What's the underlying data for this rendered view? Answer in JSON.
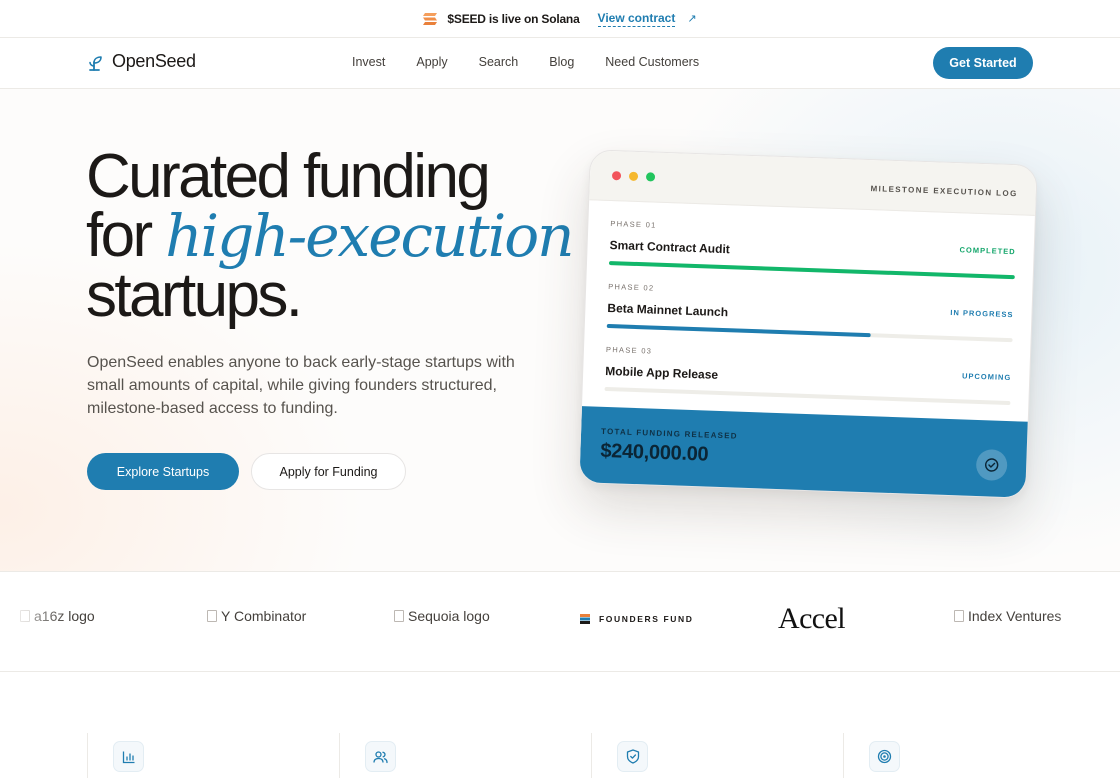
{
  "announcement": {
    "icon": "solana-icon",
    "text": "$SEED is live on Solana",
    "link_label": "View contract",
    "link_arrow": "↗"
  },
  "nav": {
    "brand": "OpenSeed",
    "links": [
      "Invest",
      "Apply",
      "Search",
      "Blog",
      "Need Customers"
    ],
    "cta": "Get Started"
  },
  "hero": {
    "title_line1": "Curated funding",
    "title_for": "for",
    "title_em": "high-execution",
    "title_line3": "startups.",
    "description": "OpenSeed enables anyone to back early-stage startups with small amounts of capital, while giving founders structured, milestone-based access to funding.",
    "primary_button": "Explore Startups",
    "secondary_button": "Apply for Funding"
  },
  "card": {
    "title": "MILESTONE EXECUTION LOG",
    "phases": [
      {
        "label": "PHASE 01",
        "name": "Smart Contract Audit",
        "status": "COMPLETED",
        "progress": 1.0,
        "status_color": "#12a56a",
        "bar_color": "#12b76a"
      },
      {
        "label": "PHASE 02",
        "name": "Beta Mainnet Launch",
        "status": "IN PROGRESS",
        "progress": 0.65,
        "status_color": "#1f7db0",
        "bar_color": "#1f7db0"
      },
      {
        "label": "PHASE 03",
        "name": "Mobile App Release",
        "status": "UPCOMING",
        "progress": 0.0,
        "status_color": "#1f7db0",
        "bar_color": "#1f7db0"
      }
    ],
    "footer_label": "TOTAL FUNDING RELEASED",
    "footer_amount": "$240,000.00"
  },
  "logos": {
    "a16z": "a16z logo",
    "yc": "Y Combinator",
    "sequoia": "Sequoia logo",
    "founders_fund": "FOUNDERS FUND",
    "accel": "Accel",
    "index": "Index Ventures"
  },
  "features": {
    "icons": [
      "bar-chart-icon",
      "users-icon",
      "shield-check-icon",
      "target-icon"
    ]
  },
  "colors": {
    "accent": "#1f7db0",
    "success": "#12b76a",
    "text": "#1c1917"
  }
}
